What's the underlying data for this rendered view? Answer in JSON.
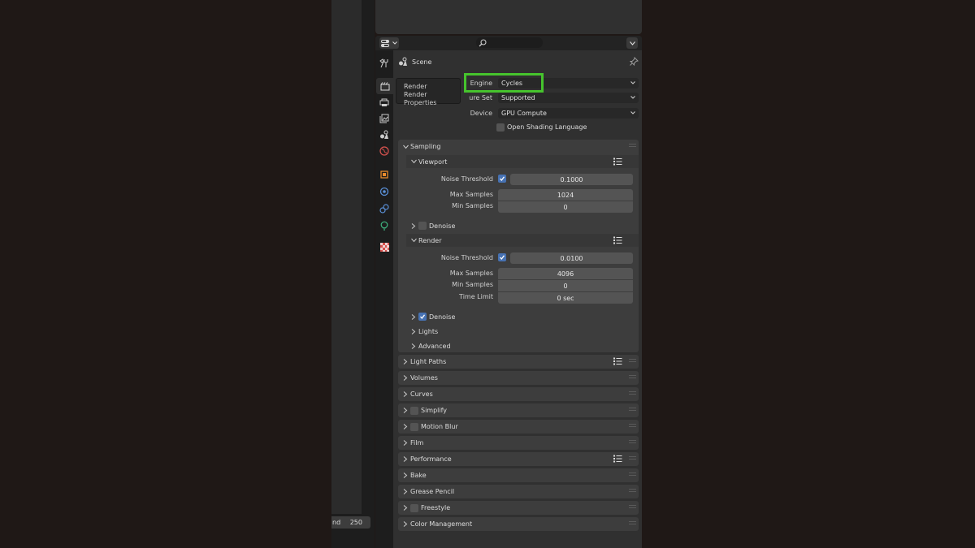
{
  "frame_range": {
    "label": "nd",
    "value": "250"
  },
  "properties": {
    "context": {
      "scene_label": "Scene"
    },
    "tooltip": {
      "line1": "Render",
      "line2": "Render Properties"
    },
    "engine_row": {
      "label": "Engine",
      "value": "Cycles"
    },
    "feature_set_row": {
      "label": "ure Set",
      "value": "Supported"
    },
    "device_row": {
      "label": "Device",
      "value": "GPU Compute"
    },
    "osl": {
      "label": "Open Shading Language",
      "checked": false
    },
    "sampling": {
      "title": "Sampling",
      "viewport": {
        "title": "Viewport",
        "noise_threshold": {
          "label": "Noise Threshold",
          "checked": true,
          "value": "0.1000"
        },
        "max_samples": {
          "label": "Max Samples",
          "value": "1024"
        },
        "min_samples": {
          "label": "Min Samples",
          "value": "0"
        },
        "denoise": {
          "label": "Denoise",
          "checked": false
        }
      },
      "render": {
        "title": "Render",
        "noise_threshold": {
          "label": "Noise Threshold",
          "checked": true,
          "value": "0.0100"
        },
        "max_samples": {
          "label": "Max Samples",
          "value": "4096"
        },
        "min_samples": {
          "label": "Min Samples",
          "value": "0"
        },
        "time_limit": {
          "label": "Time Limit",
          "value": "0 sec"
        },
        "denoise": {
          "label": "Denoise",
          "checked": true
        }
      },
      "lights": "Lights",
      "advanced": "Advanced"
    },
    "panels": [
      {
        "label": "Light Paths"
      },
      {
        "label": "Volumes"
      },
      {
        "label": "Curves"
      },
      {
        "label": "Simplify"
      },
      {
        "label": "Motion Blur"
      },
      {
        "label": "Film"
      },
      {
        "label": "Performance"
      },
      {
        "label": "Bake"
      },
      {
        "label": "Grease Pencil"
      },
      {
        "label": "Freestyle"
      },
      {
        "label": "Color Management"
      }
    ]
  },
  "colors": {
    "highlight": "#46c42d",
    "checkbox_on": "#4772b3",
    "panel_bg": "#3d3d3d",
    "editor_bg": "#303030"
  }
}
